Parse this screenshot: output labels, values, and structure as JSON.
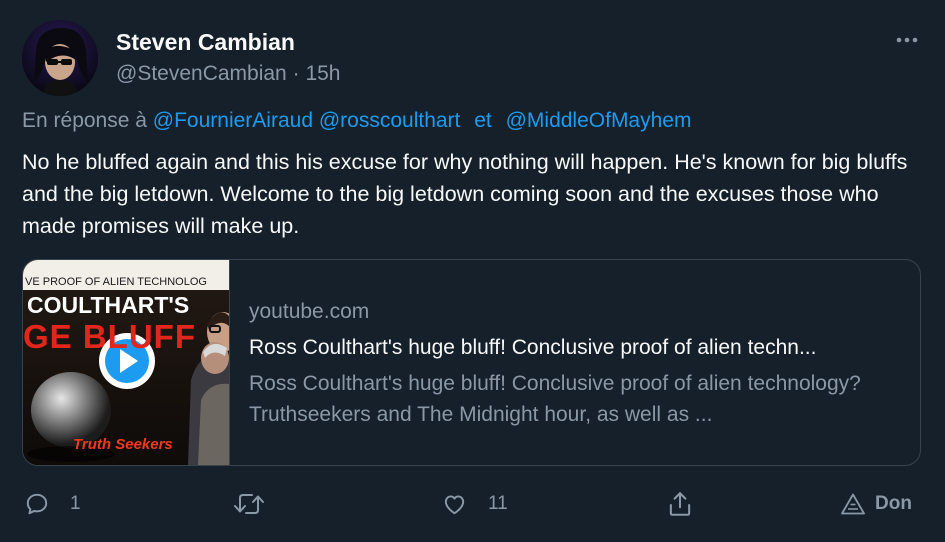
{
  "author": {
    "display_name": "Steven Cambian",
    "handle": "@StevenCambian",
    "separator": "·",
    "timestamp": "15h"
  },
  "reply": {
    "prefix": "En réponse à",
    "mention_1": "@FournierAiraud",
    "mention_2": "@rosscoulthart",
    "conjunction": "et",
    "mention_3": "@MiddleOfMayhem"
  },
  "body": "No he bluffed again and this his excuse for why nothing will happen. He's known for big bluffs and the big letdown. Welcome to the big letdown coming soon and the excuses those who made promises will make up.",
  "card": {
    "domain": "youtube.com",
    "title": "Ross Coulthart's huge bluff! Conclusive proof of alien techn...",
    "description": "Ross Coulthart's huge bluff! Conclusive proof of alien technology? Truthseekers and The Midnight hour, as well as ...",
    "thumbnail": {
      "line_1": "VE PROOF OF ALIEN TECHNOLOG",
      "line_2": "COULTHART'S",
      "line_3": "GE BLUFF",
      "logo": "Truth Seekers"
    }
  },
  "actions": {
    "reply_count": "1",
    "retweet_count": "",
    "like_count": "11",
    "donate_label": "Don"
  },
  "icons": {
    "more": "more-horizontal-icon",
    "reply": "reply-icon",
    "retweet": "retweet-icon",
    "like": "heart-icon",
    "share": "share-icon",
    "donate": "donate-icon",
    "play": "play-icon"
  },
  "colors": {
    "background": "#15202b",
    "accent": "#1d9bf0",
    "text_primary": "#f7f9f9",
    "text_secondary": "#8b98a5",
    "border": "#38444d"
  }
}
